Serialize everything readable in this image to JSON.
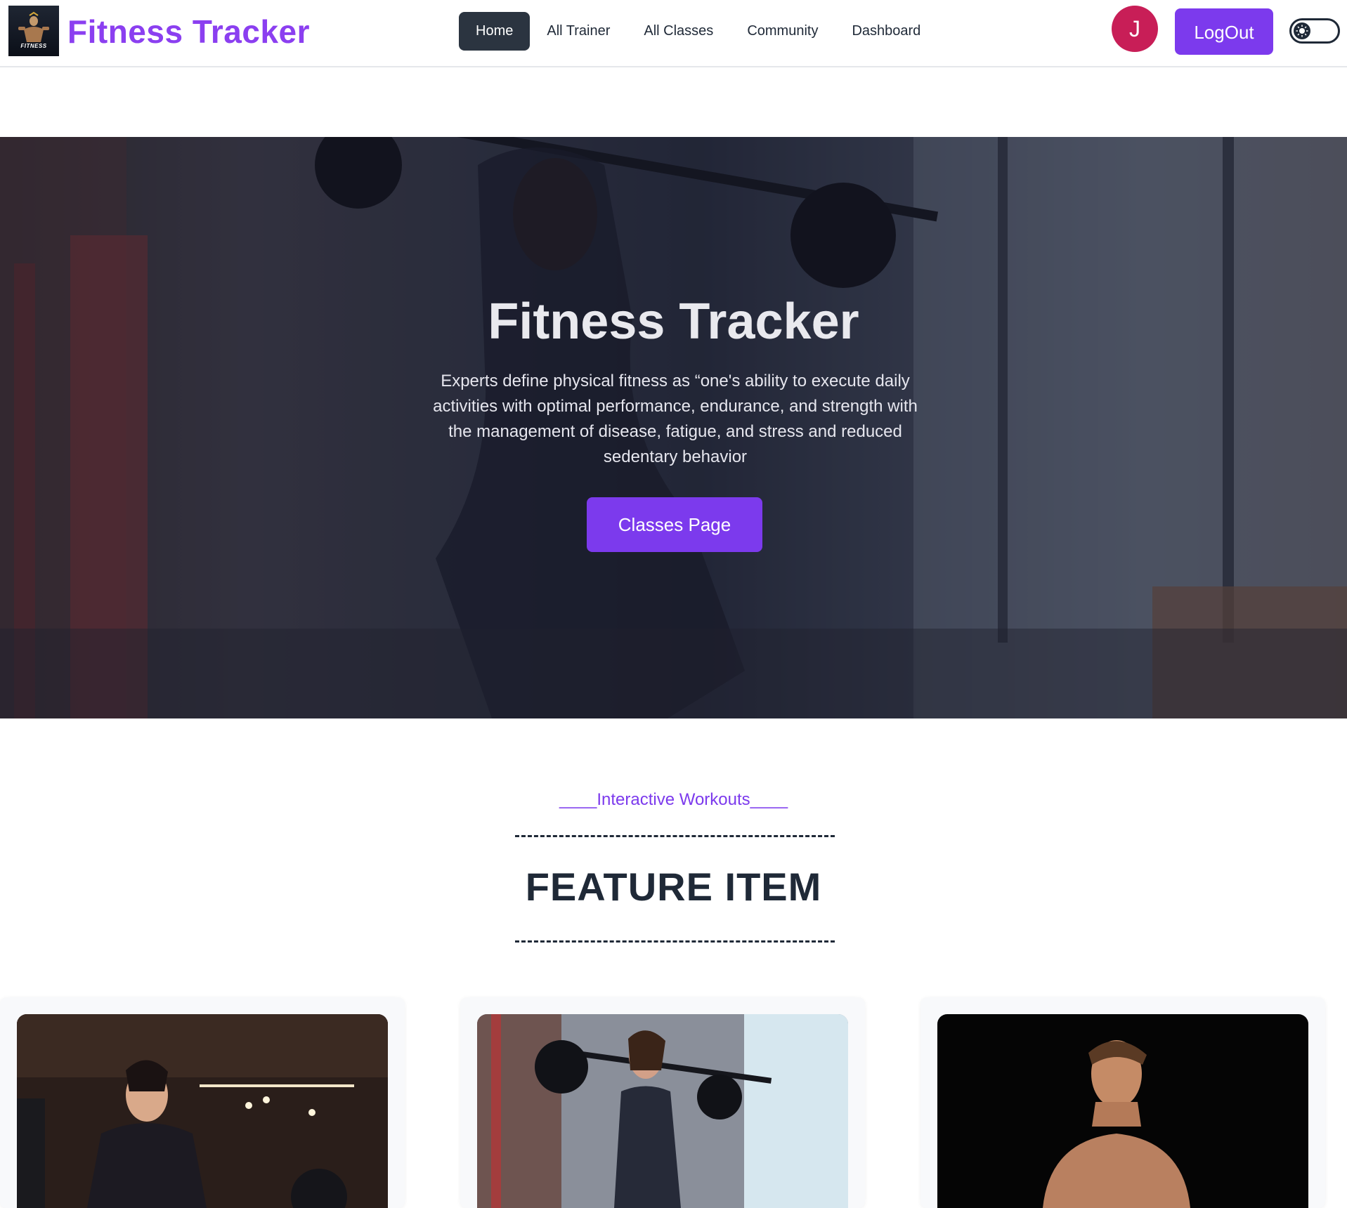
{
  "navbar": {
    "brand": "Fitness Tracker",
    "logo_text": "FITNESS",
    "links": [
      "Home",
      "All Trainer",
      "All Classes",
      "Community",
      "Dashboard"
    ],
    "active_link": "Home",
    "avatar_initial": "J",
    "logout_label": "LogOut",
    "theme_toggle_icon": "sun-icon"
  },
  "hero": {
    "title": "Fitness Tracker",
    "description": "Experts define physical fitness as “one's ability to execute daily activities with optimal performance, endurance, and strength with the management of disease, fatigue, and stress and reduced sedentary behavior",
    "button_label": "Classes Page"
  },
  "features": {
    "subtitle": "____Interactive Workouts____",
    "title": "FEATURE ITEM"
  },
  "colors": {
    "brand_purple": "#7c3aed",
    "avatar_red": "#c81e57",
    "active_nav_bg": "#2b3440"
  }
}
